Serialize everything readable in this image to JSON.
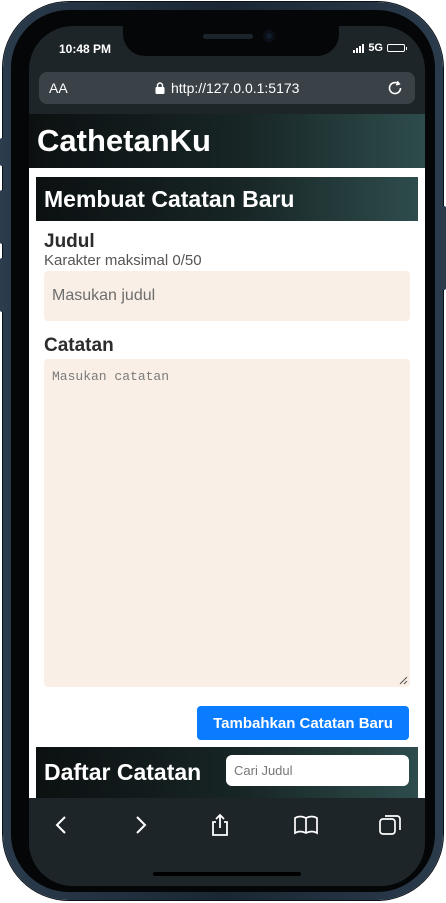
{
  "status_bar": {
    "time": "10:48 PM",
    "network": "5G",
    "battery_level": 1.0
  },
  "browser": {
    "text_size_label": "AA",
    "url": "http://127.0.0.1:5173",
    "icons": [
      "lock-icon",
      "reload-icon"
    ]
  },
  "app": {
    "title": "CathetanKu"
  },
  "create_note": {
    "heading": "Membuat Catatan Baru",
    "title_label": "Judul",
    "char_limit_text": "Karakter maksimal 0/50",
    "title_placeholder": "Masukan judul",
    "note_label": "Catatan",
    "note_placeholder": "Masukan catatan",
    "submit_label": "Tambahkan Catatan Baru"
  },
  "note_list": {
    "heading": "Daftar Catatan",
    "search_placeholder": "Cari Judul"
  },
  "toolbar": {
    "icons": [
      "back-icon",
      "forward-icon",
      "share-icon",
      "bookmarks-icon",
      "tabs-icon"
    ]
  },
  "colors": {
    "header_gradient": [
      "#0c1011",
      "#2e4c4c"
    ],
    "input_background": "#f9efe6",
    "primary_button": "#0a7cff"
  }
}
